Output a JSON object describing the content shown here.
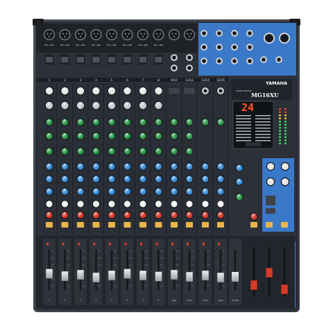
{
  "device": {
    "brand": "YAMAHA",
    "subtitle": "MIXING CONSOLE",
    "model": "MG16XU",
    "display_value": "24"
  },
  "mic_label": "MIC / LINE",
  "channel_numbers": [
    "1",
    "2",
    "3",
    "4",
    "5",
    "6",
    "7",
    "8",
    "9/10",
    "11/12",
    "13/14",
    "15/16"
  ],
  "fader_labels": [
    "1",
    "2",
    "3",
    "4",
    "5",
    "6",
    "7",
    "8",
    "9/10",
    "11/12",
    "13/14",
    "15/16"
  ],
  "group_fader_labels": [
    "FX RTN"
  ],
  "colors": {
    "chassis": "#3c4048",
    "panel": "#2c3038",
    "strip_bg": "#2a2e36",
    "blue_section": "#3a78c8",
    "knob_green": "#2f9a4a",
    "knob_blue": "#3c8ed8",
    "knob_red": "#d23a2a",
    "knob_white": "#e6e6e6",
    "button_yellow": "#e8b64a",
    "button_red": "#d43a2a",
    "fader_track": "#15181d"
  },
  "channel_count": 12
}
